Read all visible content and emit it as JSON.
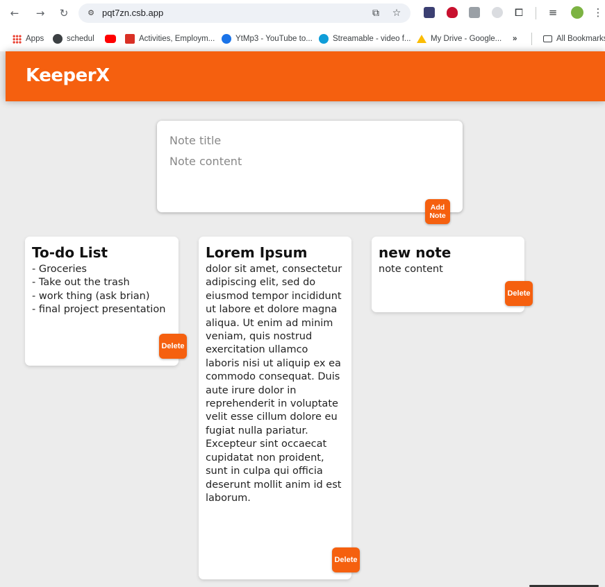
{
  "browser": {
    "url": "pqt7zn.csb.app",
    "bookmarks": [
      {
        "label": "Apps",
        "color": "#4285f4"
      },
      {
        "label": "schedul",
        "color": "#3c4043"
      },
      {
        "label": "",
        "color": "#ff0000"
      },
      {
        "label": "Activities, Employm...",
        "color": "#d93025"
      },
      {
        "label": "YtMp3 - YouTube to...",
        "color": "#1a73e8"
      },
      {
        "label": "Streamable - video f...",
        "color": "#0f9dd8"
      },
      {
        "label": "My Drive - Google...",
        "color": "#fbbc04"
      }
    ],
    "more_bookmarks": "»",
    "all_bookmarks": "All Bookmarks"
  },
  "app": {
    "title": "KeeperX",
    "accent": "#f5600f"
  },
  "create_note": {
    "title_placeholder": "Note title",
    "content_placeholder": "Note content",
    "add_label_line1": "Add",
    "add_label_line2": "Note"
  },
  "notes": [
    {
      "title": "To-do List",
      "content": "- Groceries\n- Take out the trash\n- work thing (ask brian)\n- final project presentation",
      "delete_label": "Delete"
    },
    {
      "title": "Lorem Ipsum",
      "content": "dolor sit amet, consectetur adipiscing elit, sed do eiusmod tempor incididunt ut labore et dolore magna aliqua. Ut enim ad minim veniam, quis nostrud exercitation ullamco laboris nisi ut aliquip ex ea commodo consequat. Duis aute irure dolor in reprehenderit in voluptate velit esse cillum dolore eu fugiat nulla pariatur. Excepteur sint occaecat cupidatat non proident, sunt in culpa qui officia deserunt mollit anim id est laborum.",
      "delete_label": "Delete"
    },
    {
      "title": "new note",
      "content": "note content",
      "delete_label": "Delete"
    }
  ]
}
